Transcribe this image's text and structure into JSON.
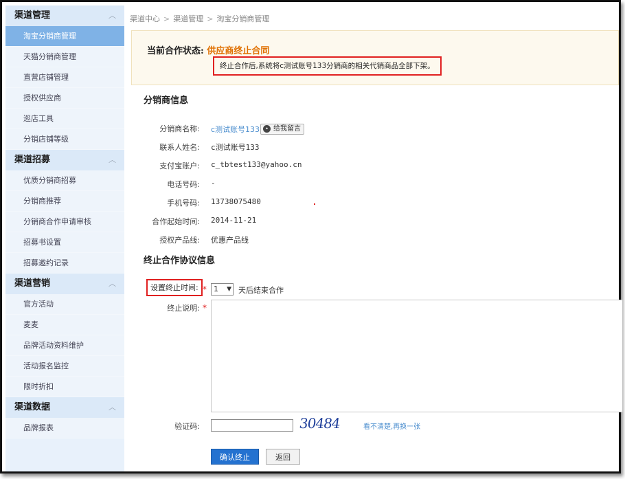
{
  "sidebar": {
    "sections": [
      {
        "title": "渠道管理",
        "items": [
          "淘宝分销商管理",
          "天猫分销商管理",
          "直营店铺管理",
          "授权供应商",
          "巡店工具",
          "分销店铺等级"
        ]
      },
      {
        "title": "渠道招募",
        "items": [
          "优质分销商招募",
          "分销商推荐",
          "分销商合作申请审核",
          "招募书设置",
          "招募邀约记录"
        ]
      },
      {
        "title": "渠道营销",
        "items": [
          "官方活动",
          "麦麦",
          "品牌活动资料维护",
          "活动报名监控",
          "限时折扣"
        ]
      },
      {
        "title": "渠道数据",
        "items": [
          "品牌报表"
        ]
      }
    ],
    "active_item": "淘宝分销商管理"
  },
  "breadcrumb": {
    "items": [
      "渠道中心",
      "渠道管理",
      "淘宝分销商管理"
    ],
    "separator": ">"
  },
  "status": {
    "label": "当前合作状态:",
    "value": "供应商终止合同",
    "notice": "终止合作后,系统将c测试账号133分销商的相关代销商品全部下架。"
  },
  "distributor_info": {
    "title": "分销商信息",
    "fields": [
      {
        "label": "分销商名称:",
        "value": "c测试账号133"
      },
      {
        "label": "联系人姓名:",
        "value": "c测试账号133"
      },
      {
        "label": "支付宝账户:",
        "value": "c_tbtest133@yahoo.cn"
      },
      {
        "label": "电话号码:",
        "value": "-"
      },
      {
        "label": "手机号码:",
        "value": "13738075480"
      },
      {
        "label": "合作起始时间:",
        "value": "2014-11-21"
      },
      {
        "label": "授权产品线:",
        "value": "优惠产品线"
      }
    ],
    "message_button": "给我留言"
  },
  "termination": {
    "title": "终止合作协议信息",
    "end_time_label": "设置终止时间:",
    "end_time_value": "1",
    "end_time_suffix": "天后结束合作",
    "description_label": "终止说明:",
    "captcha_label": "验证码:",
    "captcha_text": "30484",
    "captcha_refresh": "看不清楚,再换一张",
    "required_mark": "*",
    "confirm_button": "确认终止",
    "back_button": "返回"
  },
  "colors": {
    "accent": "#2472d0",
    "status_value": "#e07000",
    "highlight_border": "#e02020",
    "sidebar_active": "#7fb2e6"
  }
}
